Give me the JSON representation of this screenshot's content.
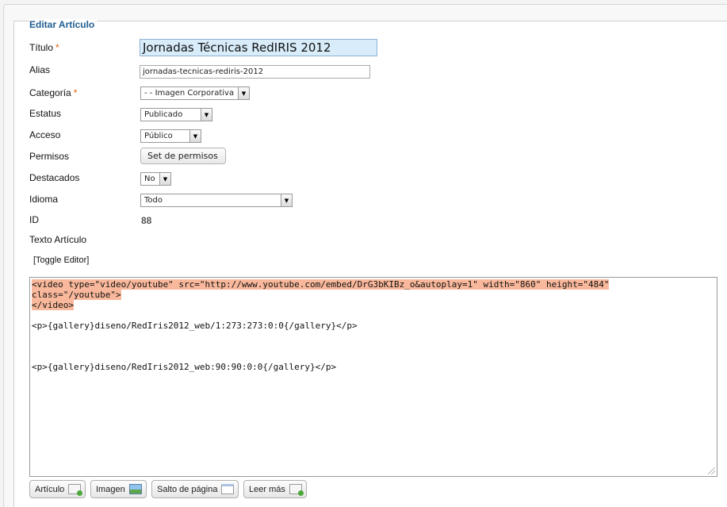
{
  "form": {
    "legend": "Editar Artículo",
    "required_mark": "*",
    "fields": {
      "title": {
        "label": "Título",
        "value": "Jornadas Técnicas RedIRIS 2012"
      },
      "alias": {
        "label": "Alias",
        "value": "jornadas-tecnicas-rediris-2012"
      },
      "category": {
        "label": "Categoría",
        "value": "- - Imagen Corporativa"
      },
      "status": {
        "label": "Estatus",
        "value": "Publicado"
      },
      "access": {
        "label": "Acceso",
        "value": "Público"
      },
      "permissions": {
        "label": "Permisos",
        "button": "Set de permisos"
      },
      "featured": {
        "label": "Destacados",
        "value": "No"
      },
      "language": {
        "label": "Idioma",
        "value": "Todo"
      },
      "id": {
        "label": "ID",
        "value": "88"
      },
      "text": {
        "label": "Texto Artículo"
      }
    },
    "toggle_editor": "[Toggle Editor]",
    "editor_lines": [
      "<video type=\"video/youtube\" src=\"http://www.youtube.com/embed/DrG3bKIBz_o&autoplay=1\" width=\"860\" height=\"484\"",
      "class=\"/youtube\">",
      "</video>",
      "<p>{gallery}diseno/RedIris2012_web/1:273:273:0:0{/gallery}</p>",
      "<p>{gallery}diseno/RedIris2012_web:90:90:0:0{/gallery}</p>"
    ],
    "editor_buttons": {
      "article": "Artículo",
      "image": "Imagen",
      "pagebreak": "Salto de página",
      "readmore": "Leer más"
    }
  },
  "icons": {
    "article": "document-plus-icon",
    "image": "image-icon",
    "pagebreak": "page-icon",
    "readmore": "document-plus-icon",
    "select_arrow": "chevron-down-icon"
  },
  "colors": {
    "legend": "#1f5d92",
    "required": "#e06000",
    "highlight": "#f9b89b",
    "title_bg": "#d8ecfa"
  }
}
